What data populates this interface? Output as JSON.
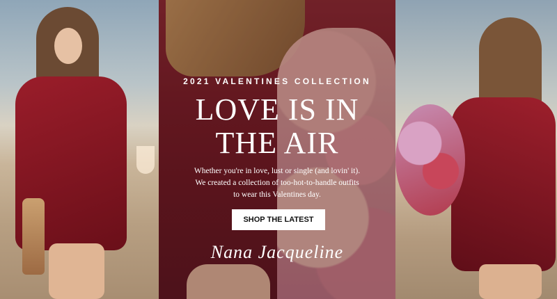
{
  "hero": {
    "eyebrow": "2021 VALENTINES COLLECTION",
    "headline_line1": "LOVE IS IN",
    "headline_line2": "THE AIR",
    "description": "Whether you're in love, lust or single (and lovin' it). We created a collection of too-hot-to-handle outfits to wear this Valentines day.",
    "cta_label": "SHOP THE LATEST",
    "signature": "Nana Jacqueline"
  },
  "colors": {
    "dress": "#8a1a26",
    "cta_bg": "#ffffff",
    "cta_text": "#111111",
    "text": "#ffffff"
  }
}
